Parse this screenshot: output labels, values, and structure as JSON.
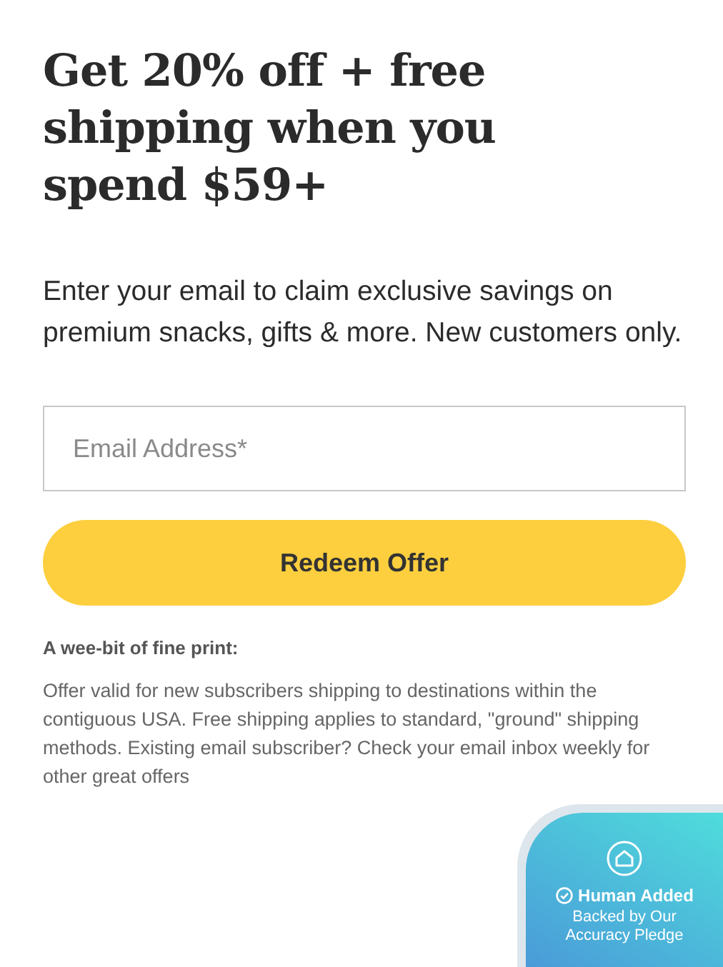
{
  "heading": "Get 20% off + free shipping when you spend $59+",
  "subtitle": "Enter your email to claim exclusive savings on premium snacks, gifts & more. New customers only.",
  "email_field": {
    "placeholder": "Email Address*"
  },
  "redeem_button": "Redeem Offer",
  "fine_print": {
    "title": "A wee-bit of fine print:",
    "text": "Offer valid for new subscribers shipping to destinations within the contiguous USA. Free shipping applies to standard, \"ground\" shipping methods. Existing email subscriber? Check your email inbox weekly for other great offers"
  },
  "badge": {
    "title": "Human Added",
    "subtitle": "Backed by Our Accuracy Pledge"
  }
}
